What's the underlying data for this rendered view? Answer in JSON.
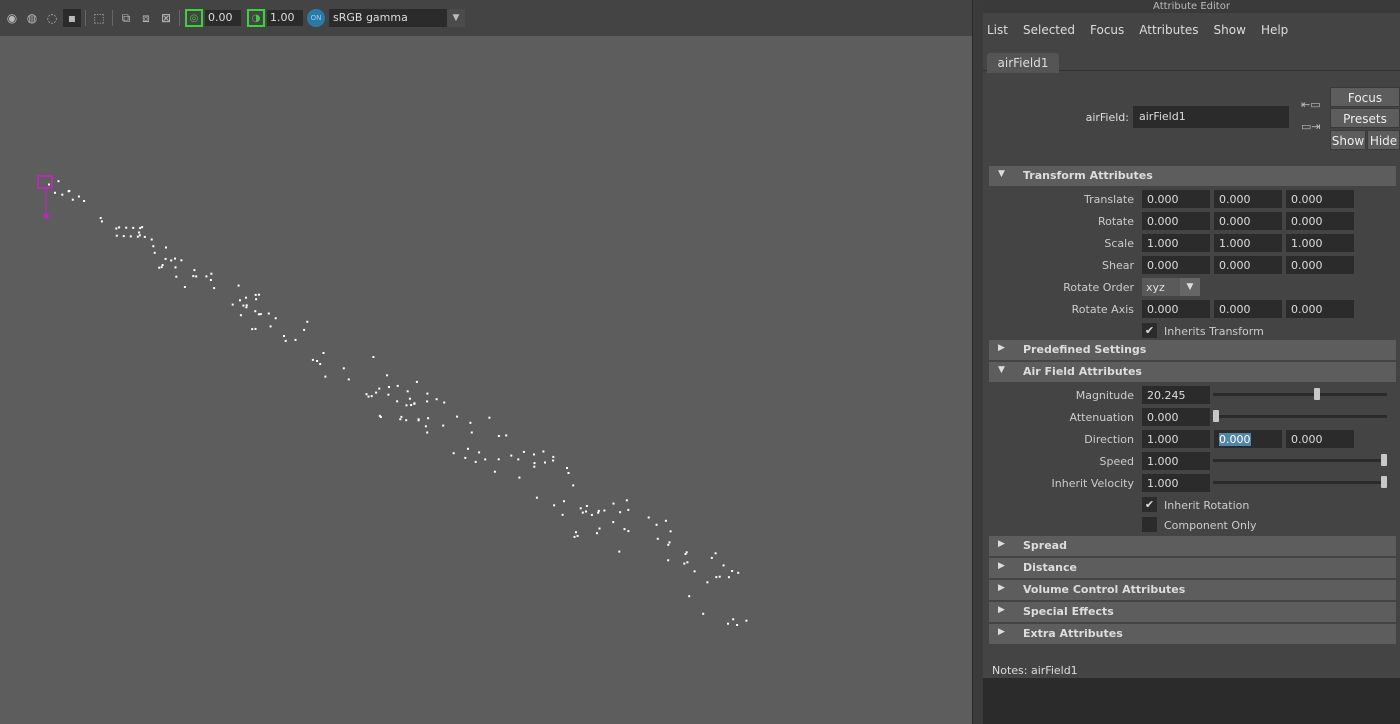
{
  "toolbar": {
    "exposure": "0.00",
    "gamma": "1.00",
    "colorspace": "sRGB gamma"
  },
  "editor": {
    "title": "Attribute Editor",
    "menu": [
      "List",
      "Selected",
      "Focus",
      "Attributes",
      "Show",
      "Help"
    ],
    "tab": "airField1",
    "node_label": "airField:",
    "node_name": "airField1",
    "buttons": {
      "focus": "Focus",
      "presets": "Presets",
      "show": "Show",
      "hide": "Hide"
    },
    "sections": {
      "transform": "Transform Attributes",
      "predefined": "Predefined Settings",
      "air": "Air Field Attributes",
      "spread": "Spread",
      "distance": "Distance",
      "volume": "Volume Control Attributes",
      "special": "Special Effects",
      "extra": "Extra Attributes"
    },
    "transform": {
      "translate_label": "Translate",
      "translate": [
        "0.000",
        "0.000",
        "0.000"
      ],
      "rotate_label": "Rotate",
      "rotate": [
        "0.000",
        "0.000",
        "0.000"
      ],
      "scale_label": "Scale",
      "scale": [
        "1.000",
        "1.000",
        "1.000"
      ],
      "shear_label": "Shear",
      "shear": [
        "0.000",
        "0.000",
        "0.000"
      ],
      "rotate_order_label": "Rotate Order",
      "rotate_order": "xyz",
      "rotate_axis_label": "Rotate Axis",
      "rotate_axis": [
        "0.000",
        "0.000",
        "0.000"
      ],
      "inherits_label": "Inherits Transform"
    },
    "air": {
      "magnitude_label": "Magnitude",
      "magnitude": "20.245",
      "magnitude_level": 0.6,
      "attenuation_label": "Attenuation",
      "attenuation": "0.000",
      "attenuation_level": 0.0,
      "direction_label": "Direction",
      "direction": [
        "1.000",
        "0.000",
        "0.000"
      ],
      "speed_label": "Speed",
      "speed": "1.000",
      "speed_level": 1.0,
      "inherit_velocity_label": "Inherit Velocity",
      "inherit_velocity": "1.000",
      "inherit_velocity_level": 1.0,
      "inherit_rotation_label": "Inherit Rotation",
      "component_only_label": "Component Only"
    },
    "notes_label": "Notes:  airField1"
  },
  "colors": {
    "viewport_bg": "#5d5d5d",
    "particle": "#ffffff",
    "field_icon": "#b12fb1",
    "selection": "#5285a6"
  }
}
